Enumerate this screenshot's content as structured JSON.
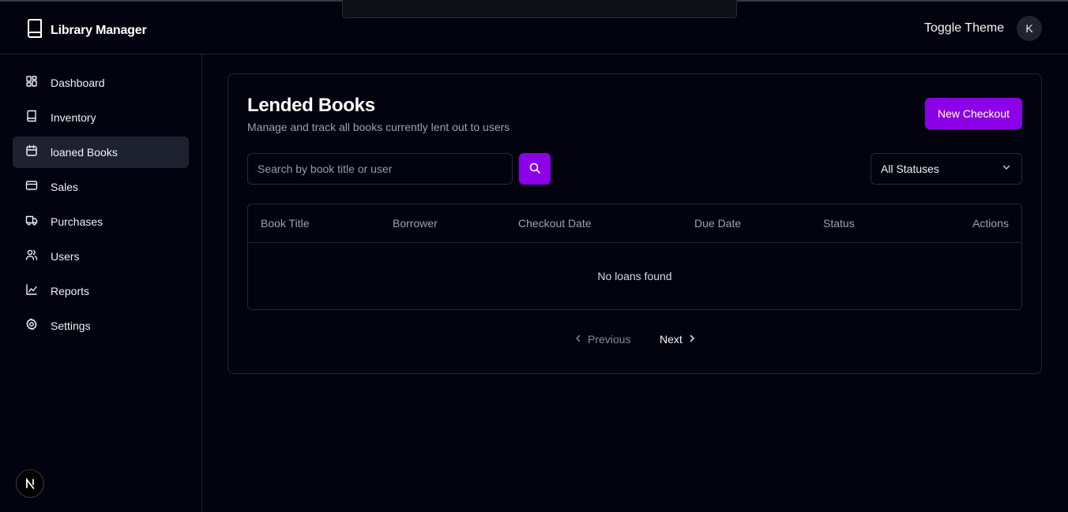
{
  "app": {
    "name": "Library Manager",
    "toggle_theme": "Toggle Theme",
    "avatar_initial": "K"
  },
  "sidebar": {
    "items": [
      {
        "label": "Dashboard",
        "icon": "dashboard-icon",
        "active": false
      },
      {
        "label": "Inventory",
        "icon": "book-icon",
        "active": false
      },
      {
        "label": "loaned Books",
        "icon": "calendar-icon",
        "active": true
      },
      {
        "label": "Sales",
        "icon": "credit-card-icon",
        "active": false
      },
      {
        "label": "Purchases",
        "icon": "truck-icon",
        "active": false
      },
      {
        "label": "Users",
        "icon": "users-icon",
        "active": false
      },
      {
        "label": "Reports",
        "icon": "line-chart-icon",
        "active": false
      },
      {
        "label": "Settings",
        "icon": "gear-icon",
        "active": false
      }
    ]
  },
  "main": {
    "title": "Lended Books",
    "subtitle": "Manage and track all books currently lent out to users",
    "new_checkout_label": "New Checkout",
    "search_placeholder": "Search by book title or user",
    "status_filter": "All Statuses",
    "table": {
      "columns": [
        "Book Title",
        "Borrower",
        "Checkout Date",
        "Due Date",
        "Status",
        "Actions"
      ],
      "rows": [],
      "empty_message": "No loans found"
    },
    "pagination": {
      "previous": "Previous",
      "next": "Next"
    }
  },
  "colors": {
    "accent": "#8b00e6",
    "background": "#03030f",
    "active_nav": "#1e2230"
  }
}
